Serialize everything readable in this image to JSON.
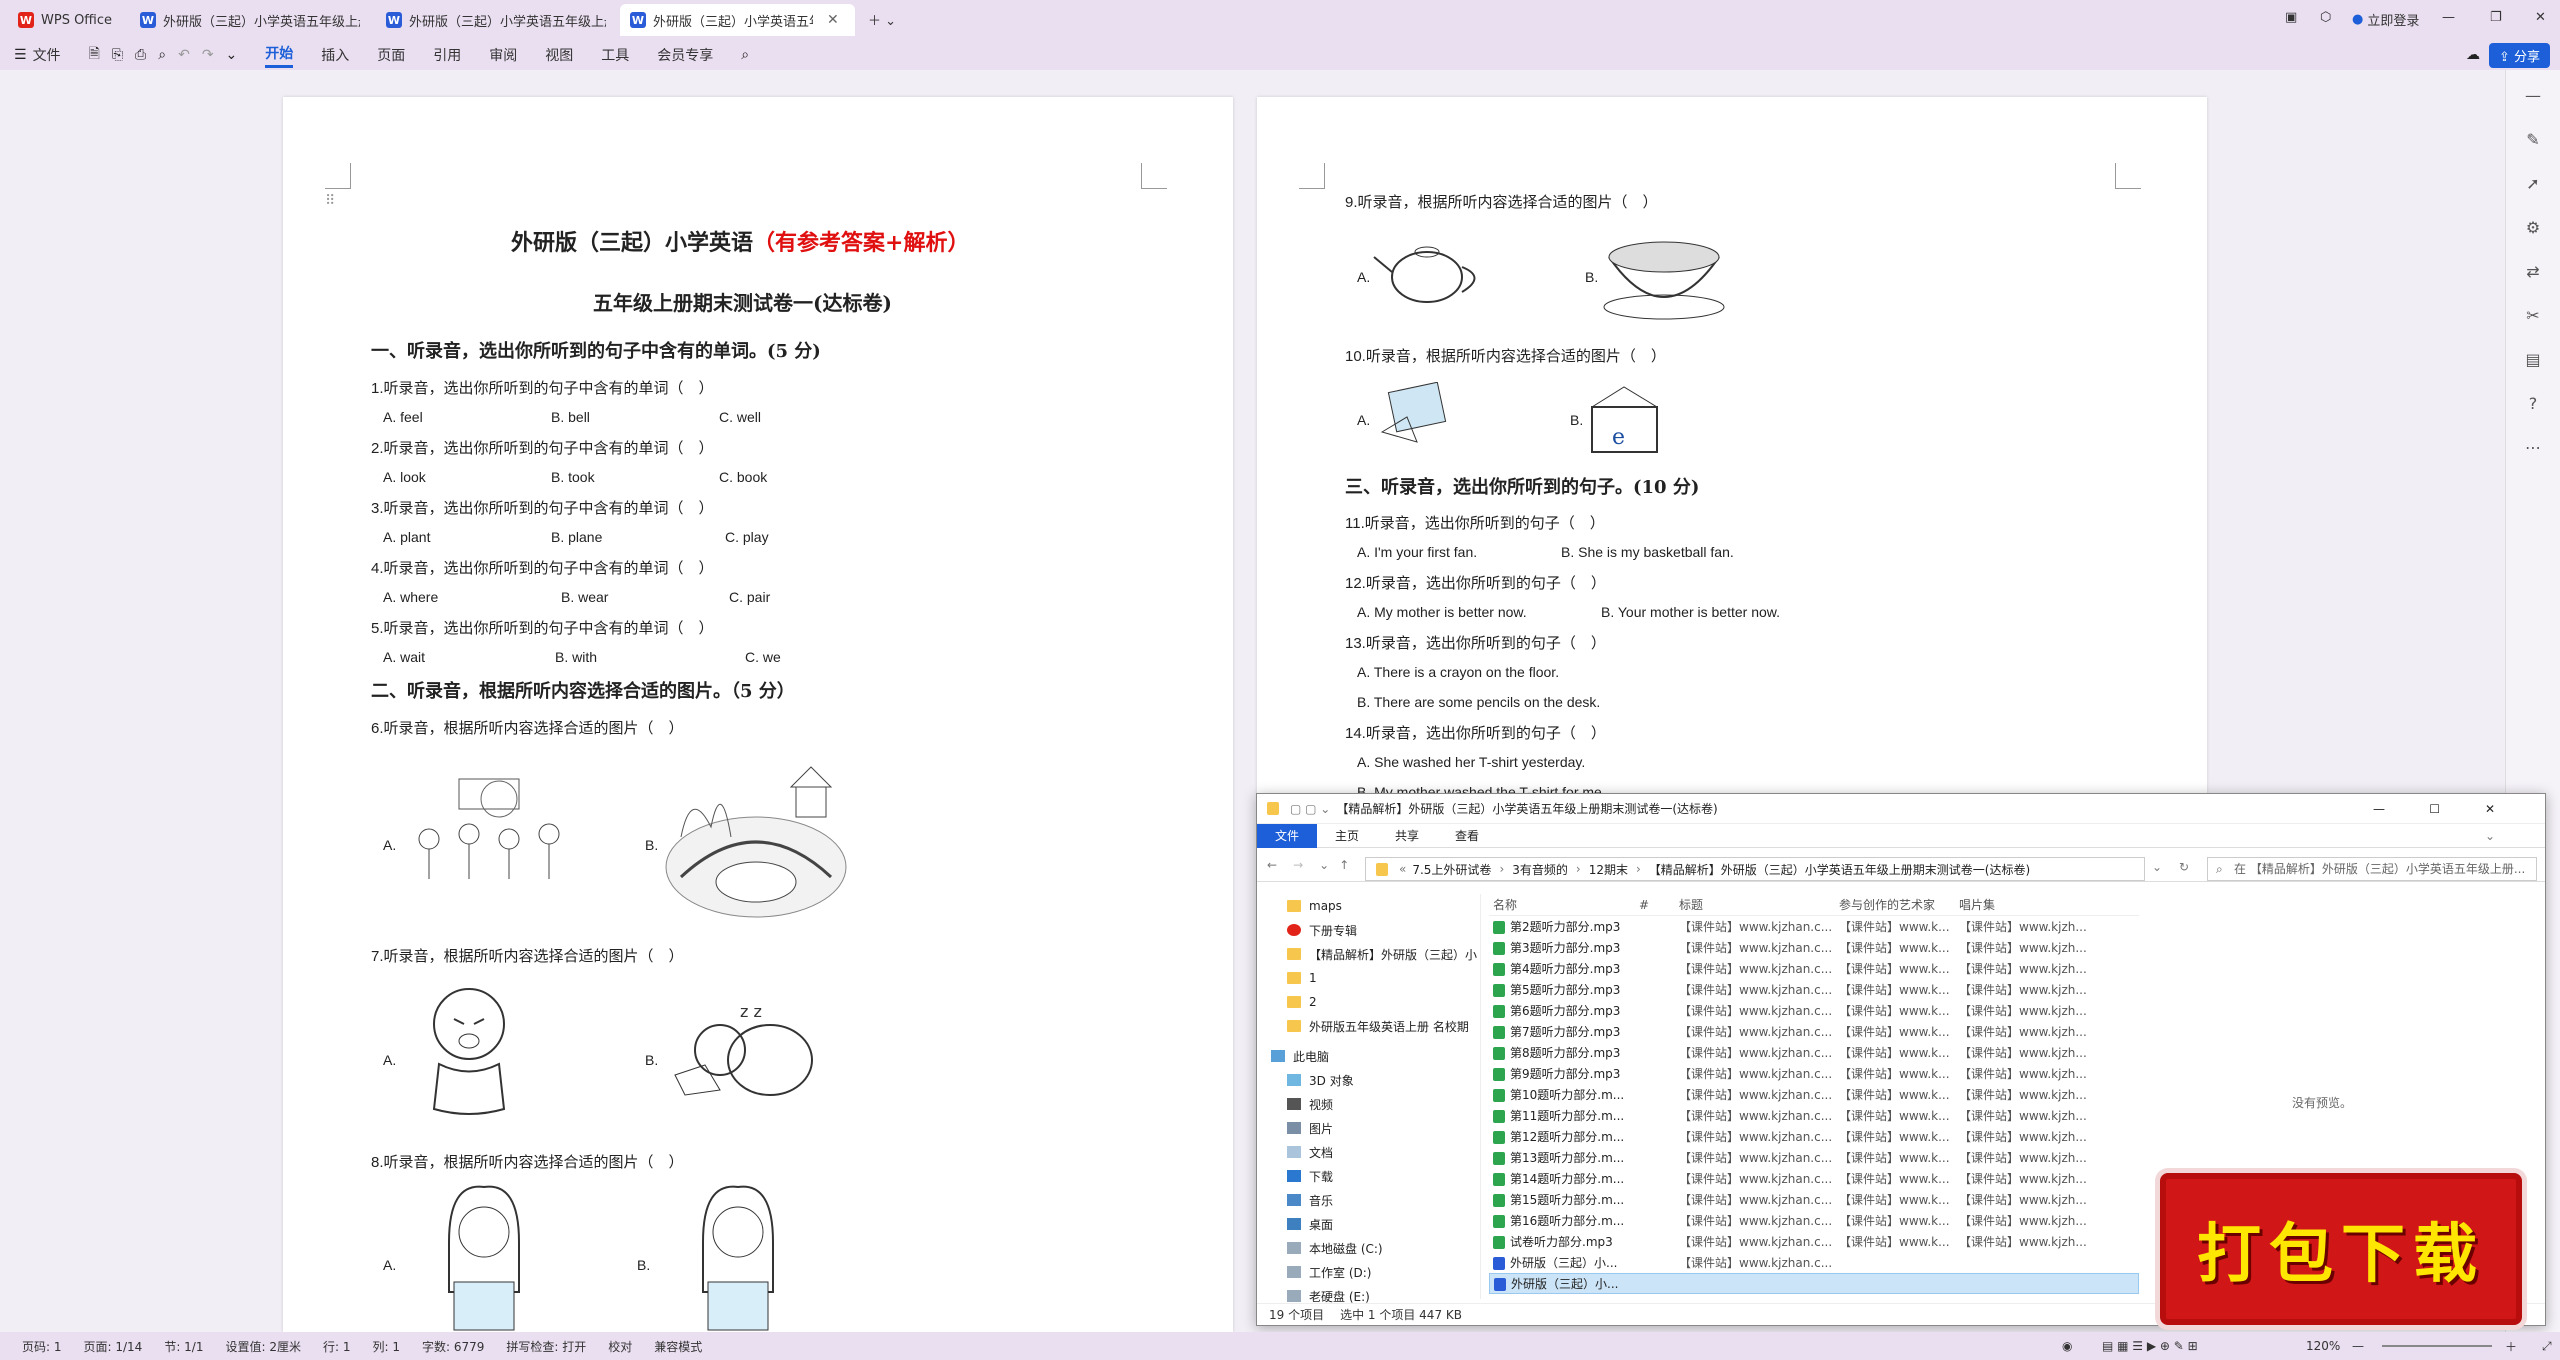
{
  "tabs": [
    {
      "label": "WPS Office",
      "icon": "wps-logo-icon"
    },
    {
      "label": "外研版（三起）小学英语五年级上册..."
    },
    {
      "label": "外研版（三起）小学英语五年级上册..."
    },
    {
      "label": "外研版（三起）小学英语五年..."
    }
  ],
  "titlebar": {
    "login": "立即登录"
  },
  "ribbon": {
    "file": "文件",
    "items": [
      "开始",
      "插入",
      "页面",
      "引用",
      "审阅",
      "视图",
      "工具",
      "会员专享"
    ],
    "share": "分享"
  },
  "page1": {
    "title_main": "外研版（三起）小学英语",
    "title_sub": "（有参考答案+解析）",
    "subtitle": "五年级上册期末测试卷一(达标卷)",
    "section1": "一、听录音，选出你所听到的句子中含有的单词。(5 分)",
    "questions": [
      {
        "q": "1.听录音，选出你所听到的句子中含有的单词（　）",
        "a": "A. feel",
        "b": "B. bell",
        "c": "C. well"
      },
      {
        "q": "2.听录音，选出你所听到的句子中含有的单词（　）",
        "a": "A. look",
        "b": "B. took",
        "c": "C. book"
      },
      {
        "q": "3.听录音，选出你所听到的句子中含有的单词（　）",
        "a": "A. plant",
        "b": "B. plane",
        "c": "C. play"
      },
      {
        "q": "4.听录音，选出你所听到的句子中含有的单词（　）",
        "a": "A. where",
        "b": "B. wear",
        "c": "C. pair"
      },
      {
        "q": "5.听录音，选出你所听到的句子中含有的单词（　）",
        "a": "A. wait",
        "b": "B. with",
        "c": "C. we"
      }
    ],
    "section2": "二、听录音，根据所听内容选择合适的图片。（5 分）",
    "pic_questions": [
      {
        "q": "6.听录音，根据所听内容选择合适的图片（　）",
        "a": "A.",
        "b": "B."
      },
      {
        "q": "7.听录音，根据所听内容选择合适的图片（　）",
        "a": "A.",
        "b": "B."
      },
      {
        "q": "8.听录音，根据所听内容选择合适的图片（　）",
        "a": "A.",
        "b": "B."
      }
    ]
  },
  "page2": {
    "pic_questions": [
      {
        "q": "9.听录音，根据所听内容选择合适的图片（　）",
        "a": "A.",
        "b": "B."
      },
      {
        "q": "10.听录音，根据所听内容选择合适的图片（　）",
        "a": "A.",
        "b": "B."
      }
    ],
    "section3": "三、听录音，选出你所听到的句子。(10 分)",
    "questions": [
      {
        "q": "11.听录音，选出你所听到的句子（　）",
        "a": "A. I'm your first fan.",
        "b": "B. She is my basketball fan."
      },
      {
        "q": "12.听录音，选出你所听到的句子（　）",
        "a": "A. My mother is better now.",
        "b": "B. Your mother is better now."
      },
      {
        "q": "13.听录音，选出你所听到的句子（　）",
        "a": "A. There is a crayon on the floor.",
        "b": "B. There are some pencils on the desk."
      },
      {
        "q": "14.听录音，选出你所听到的句子（　）",
        "a": "A. She washed her T-shirt yesterday.",
        "b": "B. My mother washed the T-shirt for me."
      }
    ]
  },
  "explorer": {
    "title": "【精品解析】外研版（三起）小学英语五年级上册期末测试卷一(达标卷)",
    "menu": [
      "文件",
      "主页",
      "共享",
      "查看"
    ],
    "breadcrumb": [
      "7.5上外研试卷",
      "3有音频的",
      "12期末",
      "【精品解析】外研版（三起）小学英语五年级上册期末测试卷一(达标卷)"
    ],
    "search_placeholder": "在 【精品解析】外研版（三起）小学英语五年级上册...",
    "nav": [
      {
        "label": "maps",
        "icon": "folder-icon"
      },
      {
        "label": "下册专辑",
        "icon": "pinned-icon"
      },
      {
        "label": "【精品解析】外研版（三起）小",
        "icon": "folder-icon"
      },
      {
        "label": "1",
        "icon": "folder-icon"
      },
      {
        "label": "2",
        "icon": "folder-icon"
      },
      {
        "label": "外研版五年级英语上册 名校期",
        "icon": "folder-icon"
      },
      {
        "label": "此电脑",
        "icon": "pc-icon"
      },
      {
        "label": "3D 对象",
        "icon": "cube-icon"
      },
      {
        "label": "视频",
        "icon": "video-icon"
      },
      {
        "label": "图片",
        "icon": "image-icon"
      },
      {
        "label": "文档",
        "icon": "document-icon"
      },
      {
        "label": "下载",
        "icon": "download-icon"
      },
      {
        "label": "音乐",
        "icon": "music-icon"
      },
      {
        "label": "桌面",
        "icon": "desktop-icon"
      },
      {
        "label": "本地磁盘 (C:)",
        "icon": "drive-icon"
      },
      {
        "label": "工作室 (D:)",
        "icon": "drive-icon"
      },
      {
        "label": "老硬盘 (E:)",
        "icon": "drive-icon"
      }
    ],
    "columns": [
      "名称",
      "#",
      "标题",
      "参与创作的艺术家",
      "唱片集"
    ],
    "files": [
      {
        "name": "第2题听力部分.mp3",
        "type": "mp3",
        "title": "【课件站】www.kjzhan.c...",
        "artist": "【课件站】www.k...",
        "album": "【课件站】www.kjzh..."
      },
      {
        "name": "第3题听力部分.mp3",
        "type": "mp3",
        "title": "【课件站】www.kjzhan.c...",
        "artist": "【课件站】www.k...",
        "album": "【课件站】www.kjzh..."
      },
      {
        "name": "第4题听力部分.mp3",
        "type": "mp3",
        "title": "【课件站】www.kjzhan.c...",
        "artist": "【课件站】www.k...",
        "album": "【课件站】www.kjzh..."
      },
      {
        "name": "第5题听力部分.mp3",
        "type": "mp3",
        "title": "【课件站】www.kjzhan.c...",
        "artist": "【课件站】www.k...",
        "album": "【课件站】www.kjzh..."
      },
      {
        "name": "第6题听力部分.mp3",
        "type": "mp3",
        "title": "【课件站】www.kjzhan.c...",
        "artist": "【课件站】www.k...",
        "album": "【课件站】www.kjzh..."
      },
      {
        "name": "第7题听力部分.mp3",
        "type": "mp3",
        "title": "【课件站】www.kjzhan.c...",
        "artist": "【课件站】www.k...",
        "album": "【课件站】www.kjzh..."
      },
      {
        "name": "第8题听力部分.mp3",
        "type": "mp3",
        "title": "【课件站】www.kjzhan.c...",
        "artist": "【课件站】www.k...",
        "album": "【课件站】www.kjzh..."
      },
      {
        "name": "第9题听力部分.mp3",
        "type": "mp3",
        "title": "【课件站】www.kjzhan.c...",
        "artist": "【课件站】www.k...",
        "album": "【课件站】www.kjzh..."
      },
      {
        "name": "第10题听力部分.m...",
        "type": "mp3",
        "title": "【课件站】www.kjzhan.c...",
        "artist": "【课件站】www.k...",
        "album": "【课件站】www.kjzh..."
      },
      {
        "name": "第11题听力部分.m...",
        "type": "mp3",
        "title": "【课件站】www.kjzhan.c...",
        "artist": "【课件站】www.k...",
        "album": "【课件站】www.kjzh..."
      },
      {
        "name": "第12题听力部分.m...",
        "type": "mp3",
        "title": "【课件站】www.kjzhan.c...",
        "artist": "【课件站】www.k...",
        "album": "【课件站】www.kjzh..."
      },
      {
        "name": "第13题听力部分.m...",
        "type": "mp3",
        "title": "【课件站】www.kjzhan.c...",
        "artist": "【课件站】www.k...",
        "album": "【课件站】www.kjzh..."
      },
      {
        "name": "第14题听力部分.m...",
        "type": "mp3",
        "title": "【课件站】www.kjzhan.c...",
        "artist": "【课件站】www.k...",
        "album": "【课件站】www.kjzh..."
      },
      {
        "name": "第15题听力部分.m...",
        "type": "mp3",
        "title": "【课件站】www.kjzhan.c...",
        "artist": "【课件站】www.k...",
        "album": "【课件站】www.kjzh..."
      },
      {
        "name": "第16题听力部分.m...",
        "type": "mp3",
        "title": "【课件站】www.kjzhan.c...",
        "artist": "【课件站】www.k...",
        "album": "【课件站】www.kjzh..."
      },
      {
        "name": "试卷听力部分.mp3",
        "type": "mp3",
        "title": "【课件站】www.kjzhan.c...",
        "artist": "【课件站】www.k...",
        "album": "【课件站】www.kjzh..."
      },
      {
        "name": "外研版（三起）小...",
        "type": "doc",
        "title": "【课件站】www.kjzhan.c...",
        "artist": "",
        "album": ""
      },
      {
        "name": "外研版（三起）小...",
        "type": "doc",
        "title": "",
        "artist": "",
        "album": "",
        "selected": true
      }
    ],
    "preview": "没有预览。",
    "status_items": "19 个项目",
    "status_selected": "选中 1 个项目  447 KB"
  },
  "statusbar": {
    "items": [
      "页码: 1",
      "页面: 1/14",
      "节: 1/1",
      "设置值: 2厘米",
      "行: 1",
      "列: 1",
      "字数: 6779",
      "拼写检查: 打开",
      "校对",
      "兼容模式"
    ],
    "zoom": "120%"
  },
  "badge": "打包下载"
}
